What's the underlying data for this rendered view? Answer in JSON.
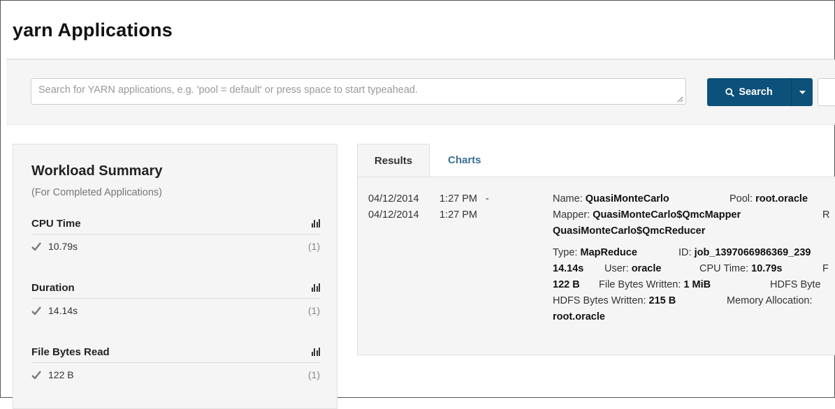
{
  "page": {
    "title": "yarn Applications"
  },
  "search": {
    "placeholder": "Search for YARN applications, e.g. 'pool = default' or press space to start typeahead.",
    "value": "",
    "button_label": "Search"
  },
  "summary": {
    "title": "Workload Summary",
    "subtitle": "(For Completed Applications)",
    "metrics": [
      {
        "name": "CPU Time",
        "value": "10.79s",
        "count": "(1)"
      },
      {
        "name": "Duration",
        "value": "14.14s",
        "count": "(1)"
      },
      {
        "name": "File Bytes Read",
        "value": "122 B",
        "count": "(1)"
      }
    ]
  },
  "tabs": [
    {
      "label": "Results",
      "active": true
    },
    {
      "label": "Charts",
      "active": false
    }
  ],
  "result": {
    "start_date": "04/12/2014",
    "start_time": "1:27 PM",
    "dash": "-",
    "end_date": "04/12/2014",
    "end_time": "1:27 PM",
    "name_label": "Name:",
    "name_value": "QuasiMonteCarlo",
    "pool_label": "Pool:",
    "pool_value": "root.oracle",
    "mapper_label": "Mapper:",
    "mapper_value": "QuasiMonteCarlo$QmcMapper",
    "reducer_cut_label": "R",
    "reducer_value": "QuasiMonteCarlo$QmcReducer",
    "type_label": "Type:",
    "type_value": "MapReduce",
    "id_label": "ID:",
    "id_value": "job_1397066986369_239",
    "duration_value": "14.14s",
    "user_label": "User:",
    "user_value": "oracle",
    "cpu_label": "CPU Time:",
    "cpu_value": "10.79s",
    "cut_f": "F",
    "file_read_value": "122 B",
    "file_written_label": "File Bytes Written:",
    "file_written_value": "1 MiB",
    "hdfs_read_cut": "HDFS Byte",
    "hdfs_written_label": "HDFS Bytes Written:",
    "hdfs_written_value": "215 B",
    "memory_label": "Memory Allocation:",
    "queue_value": "root.oracle"
  },
  "colors": {
    "primary_button": "#0c5179",
    "link_tab": "#3c6f95",
    "panel_bg": "#f5f5f5"
  }
}
